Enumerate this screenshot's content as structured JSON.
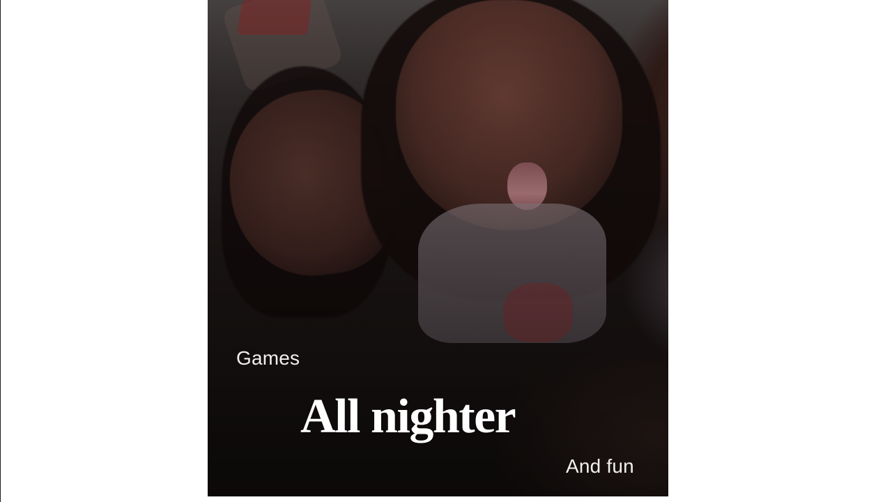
{
  "story": {
    "captions": {
      "top_left": "Games",
      "headline": "All nighter",
      "bottom_right": "And fun"
    }
  }
}
